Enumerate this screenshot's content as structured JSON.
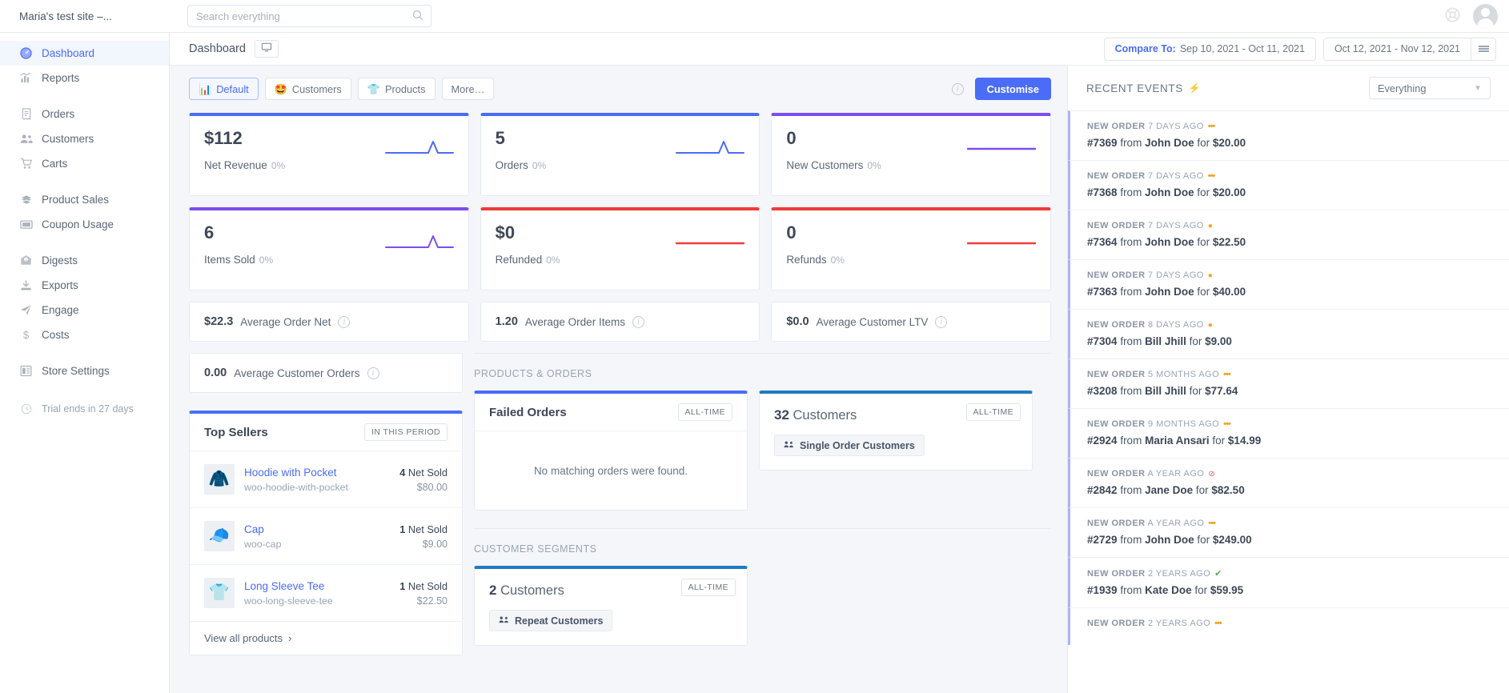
{
  "topbar": {
    "site_title": "Maria's test site –...",
    "search_placeholder": "Search everything",
    "help_icon": "lifebuoy-icon",
    "avatar_icon": "user-avatar"
  },
  "sidebar": {
    "items": [
      {
        "label": "Dashboard",
        "icon": "speedometer-icon",
        "active": true,
        "gap_after": false
      },
      {
        "label": "Reports",
        "icon": "bar-chart-icon",
        "active": false,
        "gap_after": true
      },
      {
        "label": "Orders",
        "icon": "receipt-icon",
        "active": false,
        "gap_after": false
      },
      {
        "label": "Customers",
        "icon": "users-icon",
        "active": false,
        "gap_after": false
      },
      {
        "label": "Carts",
        "icon": "cart-icon",
        "active": false,
        "gap_after": true
      },
      {
        "label": "Product Sales",
        "icon": "boxes-icon",
        "active": false,
        "gap_after": false
      },
      {
        "label": "Coupon Usage",
        "icon": "ticket-icon",
        "active": false,
        "gap_after": true
      },
      {
        "label": "Digests",
        "icon": "envelope-icon",
        "active": false,
        "gap_after": false
      },
      {
        "label": "Exports",
        "icon": "download-icon",
        "active": false,
        "gap_after": false
      },
      {
        "label": "Engage",
        "icon": "paper-plane-icon",
        "active": false,
        "gap_after": false
      },
      {
        "label": "Costs",
        "icon": "dollar-icon",
        "active": false,
        "gap_after": true
      },
      {
        "label": "Store Settings",
        "icon": "sliders-icon",
        "active": false,
        "gap_after": false
      }
    ],
    "trial_note": "Trial ends in 27 days",
    "trial_icon": "clock-icon"
  },
  "breadcrumb": {
    "title": "Dashboard",
    "screen_icon": "monitor-icon",
    "compare_label": "Compare To:",
    "compare_range": "Sep 10, 2021 - Oct 11, 2021",
    "date_range": "Oct 12, 2021 - Nov 12, 2021",
    "menu_icon": "hamburger-icon"
  },
  "tabs": [
    {
      "label": "Default",
      "emoji": "📊",
      "icon": "bar-chart-emoji",
      "active": true
    },
    {
      "label": "Customers",
      "emoji": "🤩",
      "icon": "star-face-emoji",
      "active": false
    },
    {
      "label": "Products",
      "emoji": "👕",
      "icon": "tshirt-emoji",
      "active": false
    },
    {
      "label": "More…",
      "emoji": "",
      "icon": "",
      "active": false
    }
  ],
  "toolbar": {
    "info_icon": "info-icon",
    "customise_label": "Customise"
  },
  "kpis": [
    {
      "value": "$112",
      "label": "Net Revenue",
      "delta": "0%",
      "accent": "#4a6cf7",
      "spark": "peak"
    },
    {
      "value": "5",
      "label": "Orders",
      "delta": "0%",
      "accent": "#4a6cf7",
      "spark": "peak"
    },
    {
      "value": "0",
      "label": "New Customers",
      "delta": "0%",
      "accent": "#7c4df0",
      "spark": "flat"
    },
    {
      "value": "6",
      "label": "Items Sold",
      "delta": "0%",
      "accent": "#7c4df0",
      "spark": "peak"
    },
    {
      "value": "$0",
      "label": "Refunded",
      "delta": "0%",
      "accent": "#ef3b3b",
      "spark": "flat"
    },
    {
      "value": "0",
      "label": "Refunds",
      "delta": "0%",
      "accent": "#ef3b3b",
      "spark": "flat"
    }
  ],
  "averages": [
    {
      "value": "$22.3",
      "label": "Average Order Net",
      "info_icon": "info-icon"
    },
    {
      "value": "1.20",
      "label": "Average Order Items",
      "info_icon": "info-icon"
    },
    {
      "value": "$0.0",
      "label": "Average Customer LTV",
      "info_icon": "info-icon"
    },
    {
      "value": "0.00",
      "label": "Average Customer Orders",
      "info_icon": "info-icon"
    }
  ],
  "top_sellers": {
    "title": "Top Sellers",
    "tag": "IN THIS PERIOD",
    "rows": [
      {
        "name": "Hoodie with Pocket",
        "sku": "woo-hoodie-with-pocket",
        "sold": "4",
        "sold_label": "Net Sold",
        "price": "$80.00",
        "emoji": "🧥"
      },
      {
        "name": "Cap",
        "sku": "woo-cap",
        "sold": "1",
        "sold_label": "Net Sold",
        "price": "$9.00",
        "emoji": "🧢"
      },
      {
        "name": "Long Sleeve Tee",
        "sku": "woo-long-sleeve-tee",
        "sold": "1",
        "sold_label": "Net Sold",
        "price": "$22.50",
        "emoji": "👕"
      }
    ],
    "footer": "View all products",
    "footer_icon": "chevron-right-icon"
  },
  "sections": {
    "products_orders": "PRODUCTS & ORDERS",
    "customer_segments": "CUSTOMER SEGMENTS"
  },
  "failed_orders": {
    "title": "Failed Orders",
    "tag": "ALL-TIME",
    "empty": "No matching orders were found."
  },
  "single_order_customers": {
    "count": "32",
    "noun": "Customers",
    "tag": "ALL-TIME",
    "button": "Single Order Customers",
    "button_icon": "users-group-icon"
  },
  "repeat_customers": {
    "count": "2",
    "noun": "Customers",
    "tag": "ALL-TIME",
    "button": "Repeat Customers",
    "button_icon": "users-group-icon"
  },
  "recent_events": {
    "title": "RECENT EVENTS",
    "bolt_icon": "lightning-icon",
    "filter_value": "Everything",
    "filter_chevron": "chevron-down-icon",
    "items": [
      {
        "kind": "NEW ORDER",
        "time": "7 DAYS AGO",
        "status": "dots",
        "order": "#7369",
        "customer": "John Doe",
        "amount": "$20.00"
      },
      {
        "kind": "NEW ORDER",
        "time": "7 DAYS AGO",
        "status": "dots",
        "order": "#7368",
        "customer": "John Doe",
        "amount": "$20.00"
      },
      {
        "kind": "NEW ORDER",
        "time": "7 DAYS AGO",
        "status": "pending",
        "order": "#7364",
        "customer": "John Doe",
        "amount": "$22.50"
      },
      {
        "kind": "NEW ORDER",
        "time": "7 DAYS AGO",
        "status": "pending",
        "order": "#7363",
        "customer": "John Doe",
        "amount": "$40.00"
      },
      {
        "kind": "NEW ORDER",
        "time": "8 DAYS AGO",
        "status": "pending",
        "order": "#7304",
        "customer": "Bill Jhill",
        "amount": "$9.00"
      },
      {
        "kind": "NEW ORDER",
        "time": "5 MONTHS AGO",
        "status": "dots",
        "order": "#3208",
        "customer": "Bill Jhill",
        "amount": "$77.64"
      },
      {
        "kind": "NEW ORDER",
        "time": "9 MONTHS AGO",
        "status": "dots",
        "order": "#2924",
        "customer": "Maria Ansari",
        "amount": "$14.99"
      },
      {
        "kind": "NEW ORDER",
        "time": "A YEAR AGO",
        "status": "cancelled",
        "order": "#2842",
        "customer": "Jane Doe",
        "amount": "$82.50"
      },
      {
        "kind": "NEW ORDER",
        "time": "A YEAR AGO",
        "status": "dots",
        "order": "#2729",
        "customer": "John Doe",
        "amount": "$249.00"
      },
      {
        "kind": "NEW ORDER",
        "time": "2 YEARS AGO",
        "status": "done",
        "order": "#1939",
        "customer": "Kate Doe",
        "amount": "$59.95"
      },
      {
        "kind": "NEW ORDER",
        "time": "2 YEARS AGO",
        "status": "dots",
        "order": "",
        "customer": "",
        "amount": ""
      }
    ],
    "from_word": "from",
    "for_word": "for"
  }
}
